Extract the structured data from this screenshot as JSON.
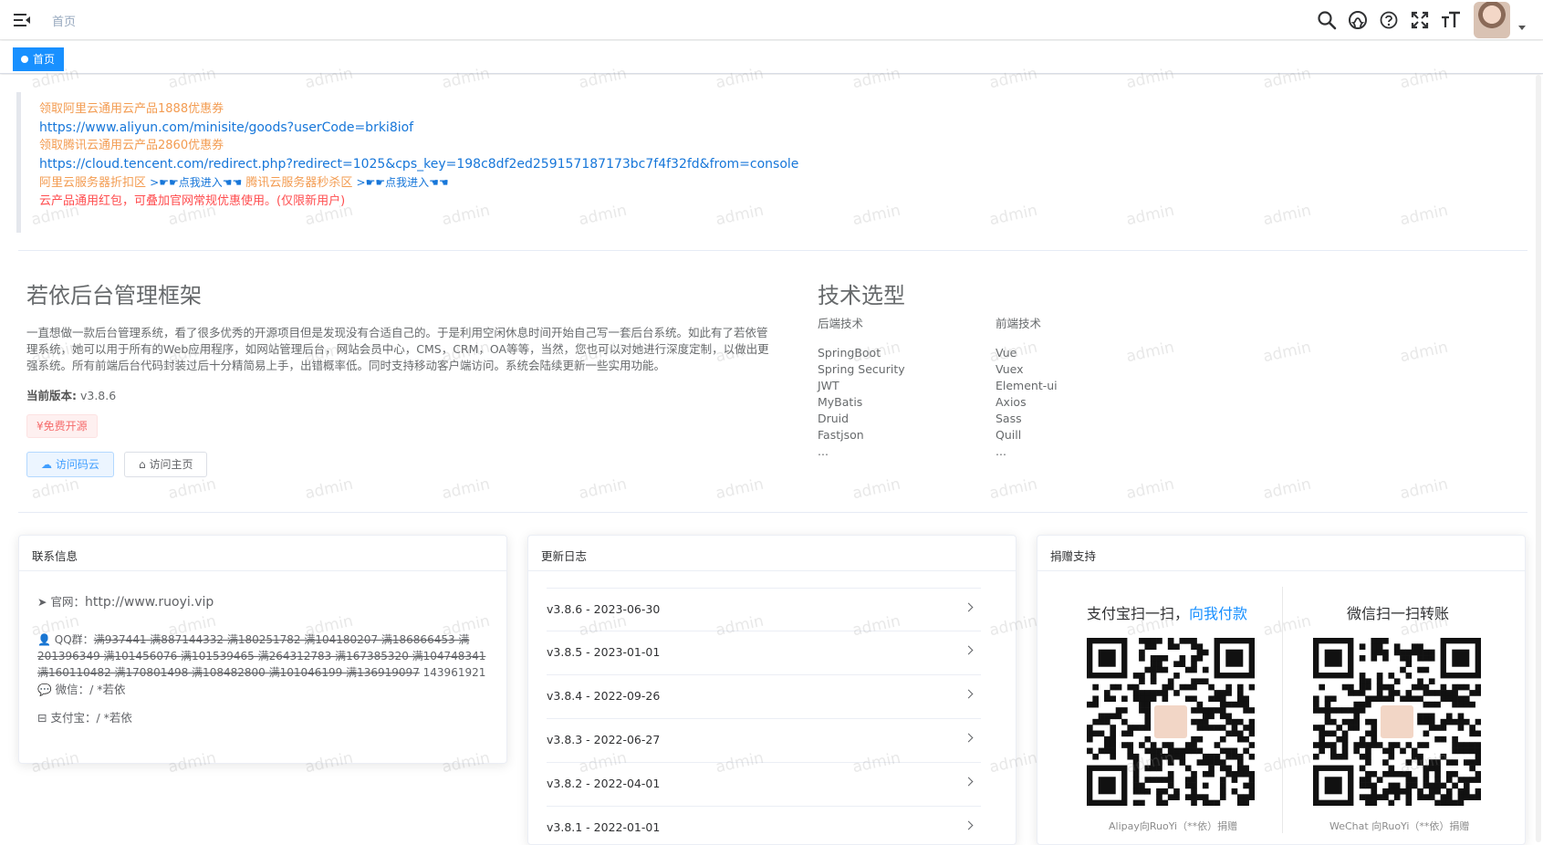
{
  "navbar": {
    "breadcrumb": "首页",
    "icons": [
      "search-icon",
      "github-icon",
      "question-icon",
      "fullscreen-icon",
      "font-size-icon"
    ]
  },
  "tags_view": {
    "active_tag": "首页"
  },
  "promo": {
    "line1": "领取阿里云通用云产品1888优惠券",
    "line2": "https://www.aliyun.com/minisite/goods?userCode=brki8iof",
    "line3": "领取腾讯云通用云产品2860优惠券",
    "line4": "https://cloud.tencent.com/redirect.php?redirect=1025&cps_key=198c8df2ed259157187173bc7f4f32fd&from=console",
    "line5_a": "阿里云服务器折扣区",
    "line5_b": ">☛☛点我进入☚☚",
    "line5_c": "腾讯云服务器秒杀区",
    "line5_d": ">☛☛点我进入☚☚",
    "line6": "云产品通用红包，可叠加官网常规优惠使用。(仅限新用户)"
  },
  "intro": {
    "title": "若依后台管理框架",
    "desc": "一直想做一款后台管理系统，看了很多优秀的开源项目但是发现没有合适自己的。于是利用空闲休息时间开始自己写一套后台系统。如此有了若依管理系统，她可以用于所有的Web应用程序，如网站管理后台，网站会员中心，CMS，CRM，OA等等，当然，您也可以对她进行深度定制，以做出更强系统。所有前端后台代码封装过后十分精简易上手，出错概率低。同时支持移动客户端访问。系统会陆续更新一些实用功能。",
    "version_label": "当前版本:",
    "version": "v3.8.6",
    "free_tag": "¥免费开源",
    "btn_gitee": "访问码云",
    "btn_home": "访问主页"
  },
  "tech": {
    "title": "技术选型",
    "backend_title": "后端技术",
    "backend": [
      "SpringBoot",
      "Spring Security",
      "JWT",
      "MyBatis",
      "Druid",
      "Fastjson",
      "..."
    ],
    "frontend_title": "前端技术",
    "frontend": [
      "Vue",
      "Vuex",
      "Element-ui",
      "Axios",
      "Sass",
      "Quill",
      "..."
    ]
  },
  "contact": {
    "header": "联系信息",
    "site_label": "官网：",
    "site": "http://www.ruoyi.vip",
    "qq_label": "QQ群：",
    "qq_struck": "满937441 满887144332 满180251782 满104180207 满186866453 满201396349 满101456076 满101539465 满264312783 满167385320 满104748341 满160110482 满170801498 满108482800 满101046199 满136919097",
    "qq_open": "143961921",
    "wechat_label": "微信：",
    "wechat": "/ *若依",
    "alipay_label": "支付宝：",
    "alipay": "/ *若依"
  },
  "changelog": {
    "header": "更新日志",
    "items": [
      "v3.8.6 - 2023-06-30",
      "v3.8.5 - 2023-01-01",
      "v3.8.4 - 2022-09-26",
      "v3.8.3 - 2022-06-27",
      "v3.8.2 - 2022-04-01",
      "v3.8.1 - 2022-01-01"
    ]
  },
  "donate": {
    "header": "捐赠支持",
    "alipay_title_a": "支付宝扫一扫，",
    "alipay_title_b": "向我付款",
    "alipay_caption": "Alipay向RuoYi（**依）捐赠",
    "wechat_title": "微信扫一扫转账",
    "wechat_caption": "WeChat 向RuoYi（**依）捐赠"
  },
  "watermark": "admin",
  "colors": {
    "primary": "#1890ff",
    "promo_orange": "#f39c52",
    "promo_red": "#ff4d4f",
    "link_blue": "#1676d9"
  }
}
